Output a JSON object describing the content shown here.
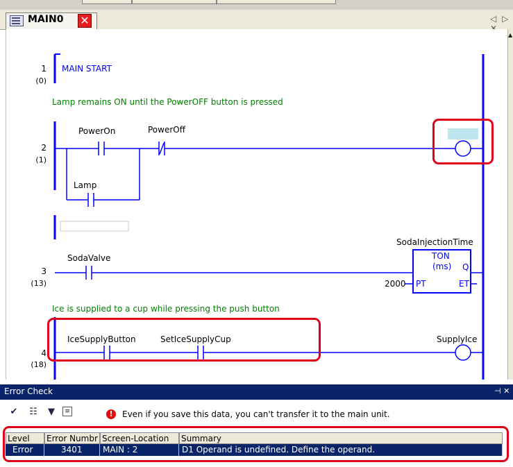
{
  "tab": {
    "label": "MAIN0",
    "close": "✕"
  },
  "rungs": [
    {
      "num": "1",
      "step": "(0)",
      "label": "MAIN START"
    },
    {
      "num": "2",
      "step": "(1)",
      "comment": "Lamp remains ON until the  PowerOFF button is pressed",
      "contacts": [
        "PowerOn",
        "PowerOff",
        "Lamp"
      ]
    },
    {
      "num": "3",
      "step": "(13)",
      "contact": "SodaValve",
      "timer": {
        "name": "SodaInjectionTime",
        "type": "TON",
        "unit": "(ms)",
        "pt_label": "PT",
        "q_label": "Q",
        "et_label": "ET",
        "pt_value": "2000"
      }
    },
    {
      "num": "4",
      "step": "(18)",
      "comment": "Ice is supplied to a cup while pressing the push button",
      "contacts": [
        "IceSupplyButton",
        "SetIceSupplyCup"
      ],
      "coil": "SupplyIce"
    }
  ],
  "error_panel": {
    "title": "Error Check",
    "toolbar_icons": [
      "check-all-icon",
      "check-icon",
      "check-select-icon",
      "list-icon"
    ],
    "warning_text": "Even if you save this data, you can't transfer it to the main unit.",
    "columns": [
      "Level",
      "Error Numbr",
      "Screen-Location",
      "Summary"
    ],
    "rows": [
      {
        "level": "Error",
        "number": "3401",
        "location": "MAIN : 2",
        "summary": "D1 Operand is undefined. Define the operand."
      }
    ]
  }
}
